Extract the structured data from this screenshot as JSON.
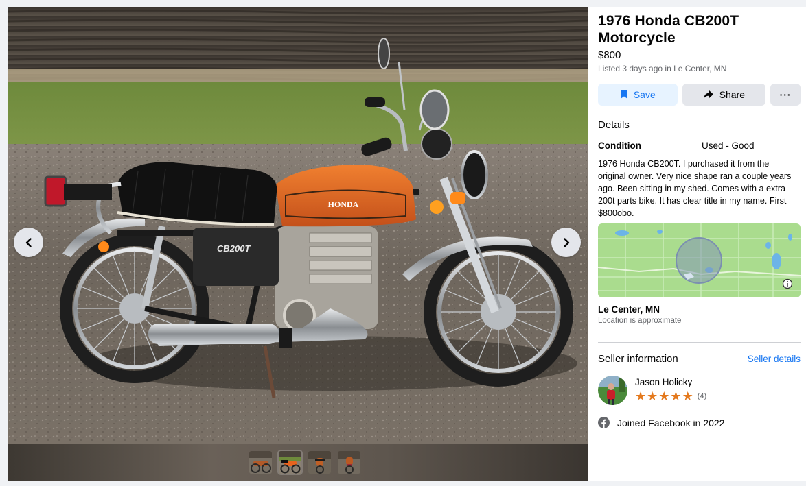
{
  "listing": {
    "title": "1976 Honda CB200T Motorcycle",
    "price": "$800",
    "listed": "Listed 3 days ago in Le Center, MN"
  },
  "actions": {
    "save_label": "Save",
    "share_label": "Share",
    "more_label": "···"
  },
  "details": {
    "heading": "Details",
    "condition_label": "Condition",
    "condition_value": "Used - Good",
    "description": "1976 Honda CB200T. I purchased it from the original owner.  Very nice shape ran a couple years ago.  Been sitting in my shed.  Comes with a extra 200t parts bike.  It has clear title in my name.  First $800obo."
  },
  "location": {
    "name": "Le Center, MN",
    "note": "Location is approximate"
  },
  "seller": {
    "heading": "Seller information",
    "details_link": "Seller details",
    "name": "Jason Holicky",
    "rating": 5,
    "rating_count": "(4)",
    "joined": "Joined Facebook in 2022"
  },
  "photo": {
    "brand_text": "HONDA",
    "model_text": "CB200T",
    "thumbnail_count": 4,
    "active_thumbnail": 2
  },
  "colors": {
    "accent": "#1877f2",
    "save_bg": "#e7f3ff",
    "star": "#e4791d",
    "tank_orange": "#e8641e"
  },
  "icons": {
    "prev": "chevron-left-icon",
    "next": "chevron-right-icon",
    "save": "bookmark-icon",
    "share": "share-arrow-icon",
    "info": "info-icon",
    "facebook": "facebook-icon"
  }
}
